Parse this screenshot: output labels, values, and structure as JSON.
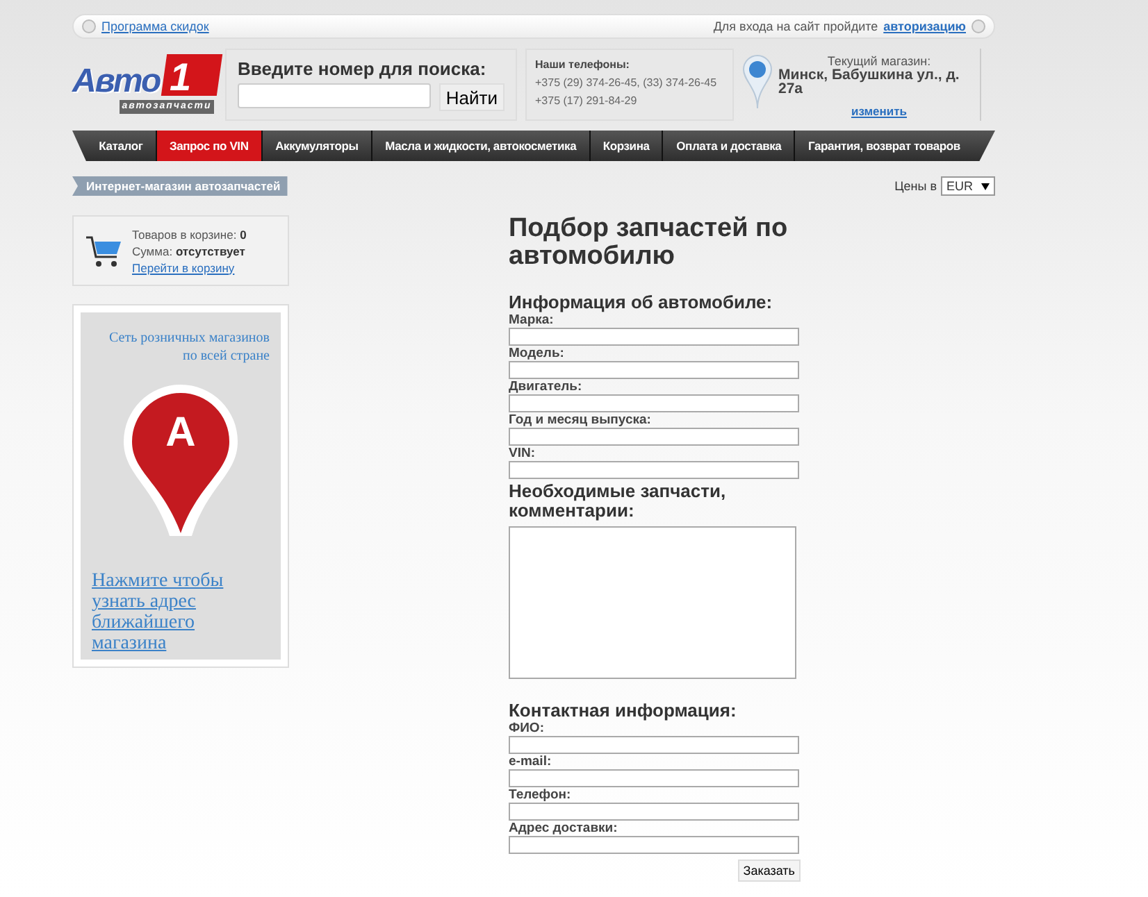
{
  "top_bar": {
    "discount_link": "Программа скидок",
    "login_prompt": "Для входа на сайт пройдите",
    "login_link": "авторизацию"
  },
  "logo": {
    "name": "Авто",
    "number": "1",
    "tagline": "автозапчасти"
  },
  "search": {
    "label": "Введите номер для поиска:",
    "button": "Найти"
  },
  "phones": {
    "title": "Наши телефоны:",
    "lines": [
      "+375 (29) 374-26-45, (33) 374-26-45",
      "+375 (17) 291-84-29"
    ]
  },
  "store": {
    "title": "Текущий магазин:",
    "address": "Минск, Бабушкина ул., д. 27а",
    "change_link": "изменить"
  },
  "nav": [
    {
      "label": "Каталог",
      "selected": false
    },
    {
      "label": "Запрос по VIN",
      "selected": true
    },
    {
      "label": "Аккумуляторы",
      "selected": false
    },
    {
      "label": "Масла и жидкости, автокосметика",
      "selected": false
    },
    {
      "label": "Корзина",
      "selected": false
    },
    {
      "label": "Оплата и доставка",
      "selected": false
    },
    {
      "label": "Гарантия, возврат товаров",
      "selected": false
    }
  ],
  "breadcrumb": "Интернет-магазин автозапчастей",
  "currency": {
    "label": "Цены в",
    "value": "EUR"
  },
  "cart": {
    "count": "Товаров в корзине: **0**",
    "sum": "Сумма: **отсутствует**",
    "link": "Перейти в корзину"
  },
  "promo": {
    "tagline": "Сеть розничных магазинов по всей стране",
    "pin_letter": "A",
    "link": "Нажмите чтобы узнать адрес ближайшего магазина"
  },
  "form": {
    "title": "Подбор запчастей по автомобилю",
    "sections": [
      {
        "heading": "Информация об автомобиле:",
        "kind": "fields",
        "fields": [
          "Марка:",
          "Модель:",
          "Двигатель:",
          "Год и месяц выпуска:",
          "VIN:"
        ]
      },
      {
        "heading": "Необходимые запчасти, комментарии:",
        "kind": "textarea"
      },
      {
        "heading": "Контактная информация:",
        "kind": "fields",
        "fields": [
          "ФИО:",
          "e-mail:",
          "Телефон:",
          "Адрес доставки:"
        ]
      }
    ],
    "submit": "Заказать"
  }
}
